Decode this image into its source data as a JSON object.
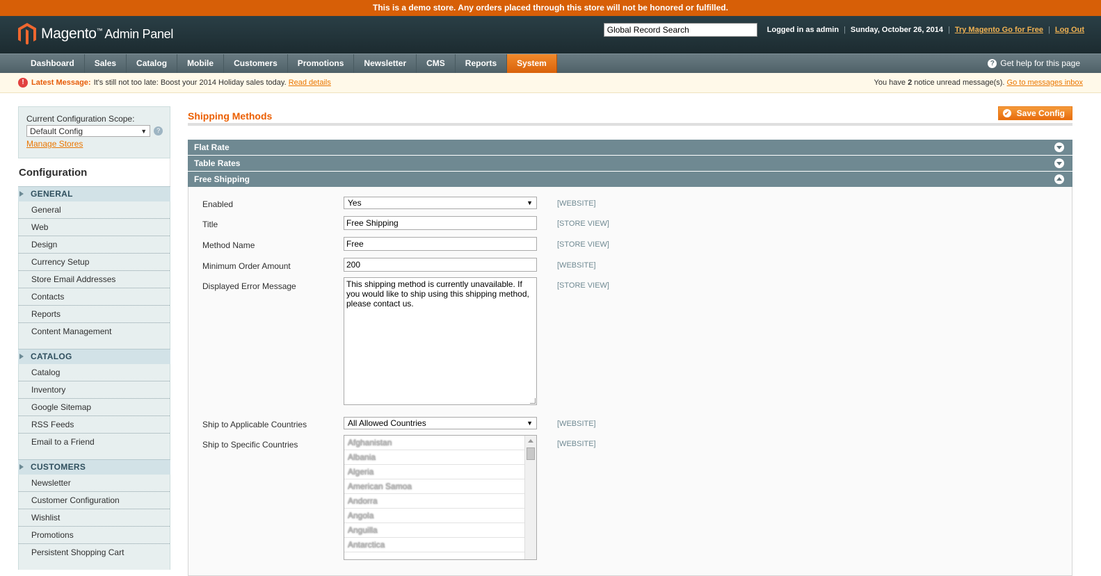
{
  "demo_notice": "This is a demo store. Any orders placed through this store will not be honored or fulfilled.",
  "header": {
    "logo_brand": "Magento",
    "logo_tm": "™",
    "logo_sub": "Admin Panel",
    "search_value": "Global Record Search",
    "logged_in": "Logged in as admin",
    "date": "Sunday, October 26, 2014",
    "try_link": "Try Magento Go for Free",
    "logout": "Log Out"
  },
  "nav": {
    "items": [
      "Dashboard",
      "Sales",
      "Catalog",
      "Mobile",
      "Customers",
      "Promotions",
      "Newsletter",
      "CMS",
      "Reports",
      "System"
    ],
    "active": "System",
    "help": "Get help for this page"
  },
  "message_bar": {
    "label": "Latest Message:",
    "text": "It's still not too late: Boost your 2014 Holiday sales today.",
    "read_details": "Read details",
    "right_prefix": "You have",
    "right_count": "2",
    "right_suffix": "notice unread message(s).",
    "inbox_link": "Go to messages inbox"
  },
  "sidebar": {
    "scope_label": "Current Configuration Scope:",
    "scope_value": "Default Config",
    "manage_stores": "Manage Stores",
    "config_title": "Configuration",
    "sections": [
      {
        "title": "GENERAL",
        "items": [
          "General",
          "Web",
          "Design",
          "Currency Setup",
          "Store Email Addresses",
          "Contacts",
          "Reports",
          "Content Management"
        ]
      },
      {
        "title": "CATALOG",
        "items": [
          "Catalog",
          "Inventory",
          "Google Sitemap",
          "RSS Feeds",
          "Email to a Friend"
        ]
      },
      {
        "title": "CUSTOMERS",
        "items": [
          "Newsletter",
          "Customer Configuration",
          "Wishlist",
          "Promotions",
          "Persistent Shopping Cart"
        ]
      }
    ]
  },
  "main": {
    "title": "Shipping Methods",
    "save_button": "Save Config",
    "fieldsets": [
      "Flat Rate",
      "Table Rates",
      "Free Shipping"
    ],
    "form": {
      "enabled": {
        "label": "Enabled",
        "value": "Yes",
        "scope": "[WEBSITE]"
      },
      "title": {
        "label": "Title",
        "value": "Free Shipping",
        "scope": "[STORE VIEW]"
      },
      "method_name": {
        "label": "Method Name",
        "value": "Free",
        "scope": "[STORE VIEW]"
      },
      "min_order": {
        "label": "Minimum Order Amount",
        "value": "200",
        "scope": "[WEBSITE]"
      },
      "error_msg": {
        "label": "Displayed Error Message",
        "value": "This shipping method is currently unavailable. If you would like to ship using this shipping method, please contact us.",
        "scope": "[STORE VIEW]"
      },
      "applicable": {
        "label": "Ship to Applicable Countries",
        "value": "All Allowed Countries",
        "scope": "[WEBSITE]"
      },
      "specific": {
        "label": "Ship to Specific Countries",
        "scope": "[WEBSITE]",
        "options": [
          "Afghanistan",
          "Albania",
          "Algeria",
          "American Samoa",
          "Andorra",
          "Angola",
          "Anguilla",
          "Antarctica"
        ]
      }
    }
  },
  "colors": {
    "accent": "#eb5e00",
    "nav_active": "#e3730f",
    "demo_bar": "#d75f07",
    "fieldset_head": "#6f8992"
  }
}
